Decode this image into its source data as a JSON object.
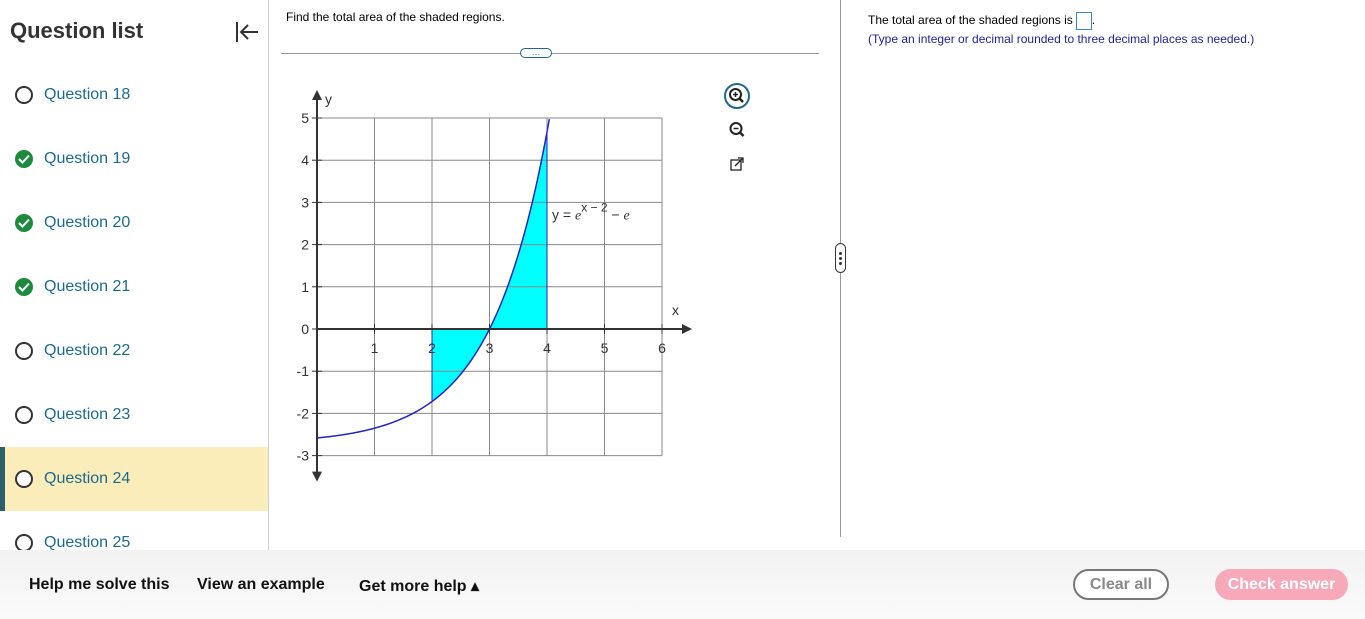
{
  "sidebar": {
    "title": "Question list",
    "collapse_icon": "collapse-left-icon",
    "items": [
      {
        "label": "Question 18",
        "status": "open"
      },
      {
        "label": "Question 19",
        "status": "done"
      },
      {
        "label": "Question 20",
        "status": "done"
      },
      {
        "label": "Question 21",
        "status": "done"
      },
      {
        "label": "Question 22",
        "status": "open"
      },
      {
        "label": "Question 23",
        "status": "open"
      },
      {
        "label": "Question 24",
        "status": "open"
      },
      {
        "label": "Question 25",
        "status": "open"
      }
    ],
    "active_item": "Question 24"
  },
  "question": {
    "prompt": "Find the total area of the shaded regions.",
    "more_label": "…"
  },
  "graph": {
    "y_axis_label": "y",
    "x_axis_label": "x",
    "x_ticks": [
      "1",
      "2",
      "3",
      "4",
      "5",
      "6"
    ],
    "y_ticks": [
      "5",
      "4",
      "3",
      "2",
      "1",
      "0",
      "-1",
      "-2",
      "-3"
    ],
    "equation_prefix": "y = ",
    "equation_base": "e",
    "equation_exponent": "x − 2",
    "equation_suffix": " − e",
    "shade_color": "#00ffff",
    "curve_color": "#2323c8"
  },
  "tools": {
    "zoom_in_icon": "zoom-in-icon",
    "zoom_out_icon": "zoom-out-icon",
    "popout_icon": "popout-icon"
  },
  "answer": {
    "text": "The total area of the shaded regions is",
    "end_punct": ".",
    "hint": "(Type an integer or decimal rounded to three decimal places as needed.)"
  },
  "footer": {
    "help_solve": "Help me solve this",
    "view_example": "View an example",
    "more_help": "Get more help ▴",
    "clear_all": "Clear all",
    "check_answer": "Check answer"
  }
}
